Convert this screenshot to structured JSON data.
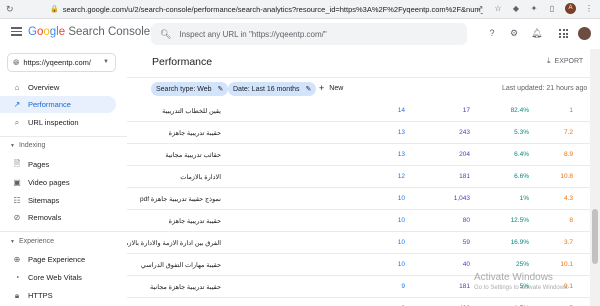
{
  "browser": {
    "url": "search.google.com/u/2/search-console/performance/search-analytics?resource_id=https%3A%2F%2Fyqeentp.com%2F&num_of_months=16&metrics=CLICK..."
  },
  "header": {
    "logo_google": [
      "G",
      "o",
      "o",
      "g",
      "l",
      "e"
    ],
    "logo_product": "Search Console",
    "search_placeholder": "Inspect any URL in \"https://yqeentp.com/\""
  },
  "sidebar": {
    "property": "https://yqeentp.com/",
    "items": [
      {
        "label": "Overview",
        "icon": "home-icon"
      },
      {
        "label": "Performance",
        "icon": "trending-up-icon"
      },
      {
        "label": "URL inspection",
        "icon": "search-icon"
      }
    ],
    "index_section": "Indexing",
    "index_items": [
      {
        "label": "Pages",
        "icon": "pages-icon"
      },
      {
        "label": "Video pages",
        "icon": "video-icon"
      },
      {
        "label": "Sitemaps",
        "icon": "sitemap-icon"
      },
      {
        "label": "Removals",
        "icon": "removals-icon"
      }
    ],
    "experience_section": "Experience",
    "experience_items": [
      {
        "label": "Page Experience",
        "icon": "page-experience-icon"
      },
      {
        "label": "Core Web Vitals",
        "icon": "speed-icon"
      },
      {
        "label": "HTTPS",
        "icon": "lock-icon"
      }
    ]
  },
  "main": {
    "title": "Performance",
    "export": "EXPORT",
    "chip_search_type": "Search type: Web",
    "chip_date": "Date: Last 16 months",
    "new_label": "New",
    "updated": "Last updated: 21 hours ago"
  },
  "rows": [
    {
      "q": "يقين للخطاب التدريبية",
      "clicks": "14",
      "impr": "17",
      "ctr": "82.4%",
      "pos": "1"
    },
    {
      "q": "حقيبة تدريبية جاهزة",
      "clicks": "13",
      "impr": "243",
      "ctr": "5.3%",
      "pos": "7.2"
    },
    {
      "q": "حقائب تدريبية مجانية",
      "clicks": "13",
      "impr": "204",
      "ctr": "6.4%",
      "pos": "8.9"
    },
    {
      "q": "الادارة بالازمات",
      "clicks": "12",
      "impr": "181",
      "ctr": "6.6%",
      "pos": "10.8"
    },
    {
      "q": "نموذج حقيبة تدريبية جاهزة pdf",
      "clicks": "10",
      "impr": "1,043",
      "ctr": "1%",
      "pos": "4.3"
    },
    {
      "q": "حقيبة تدريبية جاهزة",
      "clicks": "10",
      "impr": "80",
      "ctr": "12.5%",
      "pos": "8"
    },
    {
      "q": "الفرق بين ادارة الازمة والادارة بالازمة",
      "clicks": "10",
      "impr": "59",
      "ctr": "16.9%",
      "pos": "3.7"
    },
    {
      "q": "حقيبة مهارات التفوق الدراسي",
      "clicks": "10",
      "impr": "40",
      "ctr": "25%",
      "pos": "10.1"
    },
    {
      "q": "حقيبة تدريبية جاهزة مجانية",
      "clicks": "9",
      "impr": "181",
      "ctr": "5%",
      "pos": "9.1"
    },
    {
      "q": "حقيبة تدريبية جاهزة عن تطوير الذات مجانية",
      "clicks": "8",
      "impr": "480",
      "ctr": "1.7%",
      "pos": "7"
    }
  ],
  "watermark": {
    "title": "Activate Windows",
    "subtitle": "Go to Settings to activate Windows."
  },
  "colors": {
    "accent": "#1a73e8",
    "impressions": "#5e35b1",
    "ctr": "#00897b",
    "position": "#e8710a",
    "chip": "#d2e3fc"
  }
}
